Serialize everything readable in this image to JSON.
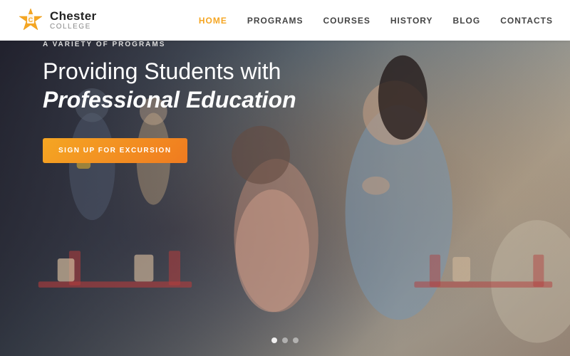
{
  "header": {
    "logo": {
      "name": "Chester",
      "sub": "College"
    },
    "nav": [
      {
        "label": "HOME",
        "active": true
      },
      {
        "label": "PROGRAMS",
        "active": false
      },
      {
        "label": "COURSES",
        "active": false
      },
      {
        "label": "HISTORY",
        "active": false
      },
      {
        "label": "BLOG",
        "active": false
      },
      {
        "label": "CONTACTS",
        "active": false
      }
    ]
  },
  "hero": {
    "subtitle": "A VARIETY OF PROGRAMS",
    "title_line1": "Providing Students with",
    "title_line2": "Professional Education",
    "cta_label": "SIGN UP FOR EXCURSION"
  },
  "dots": [
    {
      "active": true
    },
    {
      "active": false
    },
    {
      "active": false
    }
  ],
  "colors": {
    "accent": "#f5a623",
    "nav_active": "#f5a623",
    "white": "#ffffff"
  }
}
